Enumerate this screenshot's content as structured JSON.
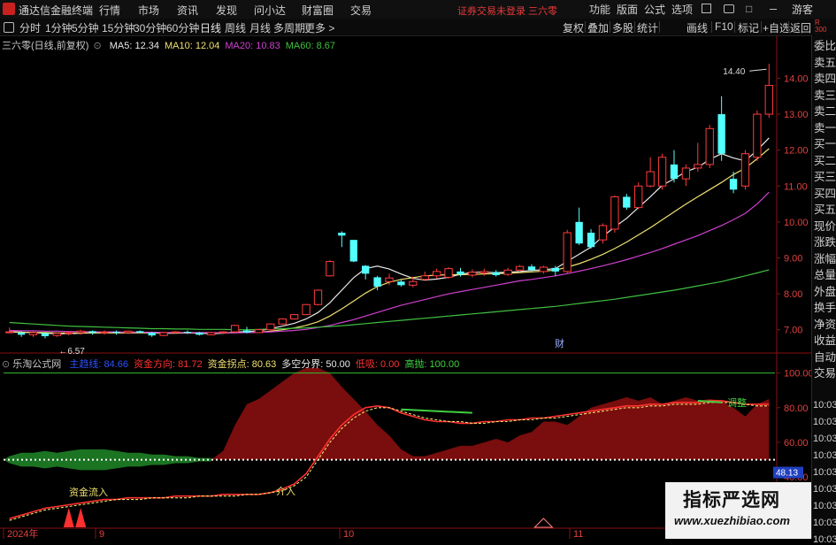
{
  "app": {
    "title": "通达信金融终端",
    "status": "证券交易未登录  三六零"
  },
  "menu": [
    "行情",
    "市场",
    "资讯",
    "发现",
    "问小达",
    "财富圈",
    "交易"
  ],
  "top_right": [
    "功能",
    "版面",
    "公式",
    "选项",
    "游客"
  ],
  "periods": [
    "分时",
    "1分钟",
    "5分钟",
    "15分钟",
    "30分钟",
    "60分钟",
    "日线",
    "周线",
    "月线",
    "多周期",
    "更多 >"
  ],
  "tools": [
    "复权",
    "叠加",
    "多股",
    "统计",
    "画线",
    "F10",
    "标记",
    "+自选",
    "返回"
  ],
  "stock": {
    "name": "三六零(日线,前复权)"
  },
  "ma_legend": [
    {
      "label": "MA5: 12.34",
      "color": "#e8e8e8"
    },
    {
      "label": "MA10: 12.04",
      "color": "#f0e070"
    },
    {
      "label": "MA20: 10.83",
      "color": "#d040d0"
    },
    {
      "label": "MA60: 8.67",
      "color": "#40c040"
    }
  ],
  "indicator": {
    "name": "乐淘公式网",
    "items": [
      {
        "label": "主趋线: 84.66",
        "color": "#3050ff"
      },
      {
        "label": "资金方向: 81.72",
        "color": "#ff3030"
      },
      {
        "label": "资金拐点: 80.63",
        "color": "#f0e070"
      },
      {
        "label": "多空分界: 50.00",
        "color": "#e8e8e8"
      },
      {
        "label": "低吸: 0.00",
        "color": "#ff3030"
      },
      {
        "label": "高抛: 100.00",
        "color": "#40d040"
      }
    ]
  },
  "right_panel": [
    "委比",
    "卖五",
    "卖四",
    "卖三",
    "卖二",
    "卖一",
    "买一",
    "买二",
    "买三",
    "买四",
    "买五",
    "现价",
    "涨跌",
    "涨幅",
    "总量",
    "外盘",
    "换手",
    "净资",
    "收益",
    "自动",
    "交易"
  ],
  "right_times": [
    "10:03",
    "10:03",
    "10:03",
    "10:03",
    "10:03",
    "10:03",
    "10:03",
    "10:03",
    "10:03"
  ],
  "annotations": {
    "high": "14.40",
    "low": "6.57",
    "cai": "财",
    "zijin": "资金流入",
    "jieru": "介入",
    "tiaozheng": "调整",
    "current": "48.13"
  },
  "x_labels": [
    "2024年",
    "9",
    "10",
    "11"
  ],
  "watermark": {
    "line1": "指标严选网",
    "line2": "www.xuezhibiao.com"
  },
  "chart_data": [
    {
      "type": "candlestick",
      "title": "三六零(日线,前复权)",
      "yticks": [
        7.0,
        8.0,
        9.0,
        10.0,
        11.0,
        12.0,
        13.0,
        14.0
      ],
      "ylim": [
        6.45,
        14.75
      ],
      "xlabels": [
        "2024年",
        "9",
        "10",
        "11"
      ],
      "candles": [
        [
          6.94,
          6.94,
          7.06,
          6.9,
          "up"
        ],
        [
          6.92,
          6.86,
          6.96,
          6.8,
          "down"
        ],
        [
          6.86,
          6.92,
          6.96,
          6.8,
          "up"
        ],
        [
          6.9,
          6.82,
          6.92,
          6.76,
          "down"
        ],
        [
          6.84,
          6.9,
          6.92,
          6.8,
          "up"
        ],
        [
          6.9,
          6.92,
          6.96,
          6.84,
          "up"
        ],
        [
          6.92,
          6.96,
          7.0,
          6.86,
          "up"
        ],
        [
          6.96,
          6.92,
          6.98,
          6.86,
          "down"
        ],
        [
          6.92,
          6.94,
          6.98,
          6.86,
          "up"
        ],
        [
          6.94,
          6.92,
          6.98,
          6.86,
          "down"
        ],
        [
          6.92,
          6.96,
          6.98,
          6.88,
          "up"
        ],
        [
          6.96,
          6.92,
          6.98,
          6.9,
          "down"
        ],
        [
          6.92,
          6.84,
          6.94,
          6.8,
          "down"
        ],
        [
          6.84,
          6.92,
          6.94,
          6.82,
          "up"
        ],
        [
          6.92,
          6.94,
          6.96,
          6.88,
          "up"
        ],
        [
          6.94,
          6.92,
          6.98,
          6.88,
          "down"
        ],
        [
          6.92,
          6.86,
          6.94,
          6.84,
          "down"
        ],
        [
          6.86,
          6.92,
          6.94,
          6.84,
          "up"
        ],
        [
          6.92,
          6.94,
          6.96,
          6.9,
          "up"
        ],
        [
          6.94,
          7.12,
          7.14,
          6.92,
          "up"
        ],
        [
          6.98,
          6.92,
          7.08,
          6.9,
          "down"
        ],
        [
          6.92,
          7.0,
          7.02,
          6.92,
          "up"
        ],
        [
          7.0,
          7.16,
          7.18,
          6.98,
          "up"
        ],
        [
          7.16,
          7.3,
          7.32,
          7.14,
          "up"
        ],
        [
          7.3,
          7.42,
          7.44,
          7.28,
          "up"
        ],
        [
          7.42,
          7.7,
          7.72,
          7.4,
          "up"
        ],
        [
          7.7,
          8.1,
          8.12,
          7.68,
          "up"
        ],
        [
          8.5,
          8.9,
          8.94,
          8.48,
          "up"
        ],
        [
          9.7,
          9.62,
          9.74,
          9.3,
          "down"
        ],
        [
          9.5,
          8.9,
          9.5,
          8.88,
          "down"
        ],
        [
          8.78,
          8.56,
          8.8,
          8.4,
          "down"
        ],
        [
          8.46,
          8.2,
          8.5,
          8.1,
          "down"
        ],
        [
          8.34,
          8.44,
          8.56,
          8.24,
          "up"
        ],
        [
          8.34,
          8.24,
          8.4,
          8.2,
          "down"
        ],
        [
          8.24,
          8.34,
          8.48,
          8.18,
          "up"
        ],
        [
          8.4,
          8.5,
          8.62,
          8.36,
          "up"
        ],
        [
          8.5,
          8.62,
          8.7,
          8.42,
          "up"
        ],
        [
          8.46,
          8.7,
          8.74,
          8.42,
          "up"
        ],
        [
          8.62,
          8.54,
          8.72,
          8.48,
          "down"
        ],
        [
          8.52,
          8.6,
          8.68,
          8.46,
          "up"
        ],
        [
          8.58,
          8.62,
          8.7,
          8.5,
          "up"
        ],
        [
          8.6,
          8.52,
          8.66,
          8.48,
          "down"
        ],
        [
          8.54,
          8.66,
          8.72,
          8.5,
          "up"
        ],
        [
          8.66,
          8.76,
          8.8,
          8.6,
          "up"
        ],
        [
          8.76,
          8.66,
          8.82,
          8.62,
          "down"
        ],
        [
          8.62,
          8.74,
          8.78,
          8.56,
          "up"
        ],
        [
          8.72,
          8.62,
          8.78,
          8.5,
          "down"
        ],
        [
          8.62,
          9.7,
          9.78,
          8.58,
          "up"
        ],
        [
          10.0,
          9.4,
          10.4,
          9.36,
          "down"
        ],
        [
          9.7,
          9.3,
          9.8,
          9.26,
          "down"
        ],
        [
          9.5,
          9.9,
          9.96,
          9.4,
          "up"
        ],
        [
          9.8,
          10.7,
          10.74,
          9.7,
          "up"
        ],
        [
          10.7,
          10.4,
          10.78,
          10.34,
          "down"
        ],
        [
          10.4,
          11.0,
          11.1,
          10.36,
          "up"
        ],
        [
          11.0,
          11.4,
          11.8,
          10.96,
          "up"
        ],
        [
          11.0,
          11.8,
          11.9,
          10.9,
          "up"
        ],
        [
          11.6,
          11.2,
          12.0,
          11.1,
          "down"
        ],
        [
          11.2,
          11.5,
          11.6,
          11.0,
          "up"
        ],
        [
          11.5,
          11.6,
          12.2,
          11.4,
          "up"
        ],
        [
          11.6,
          12.6,
          12.7,
          11.5,
          "up"
        ],
        [
          13.0,
          11.9,
          13.5,
          11.7,
          "down"
        ],
        [
          11.2,
          10.9,
          11.4,
          10.8,
          "down"
        ],
        [
          11.0,
          11.9,
          12.0,
          10.9,
          "up"
        ],
        [
          11.8,
          13.0,
          13.1,
          11.7,
          "up"
        ],
        [
          13.0,
          13.8,
          14.4,
          12.9,
          "up"
        ]
      ],
      "ma_lines": [
        {
          "name": "MA5",
          "color": "#e8e8e8",
          "values": [
            6.95,
            6.93,
            6.92,
            6.9,
            6.89,
            6.89,
            6.9,
            6.91,
            6.92,
            6.92,
            6.93,
            6.93,
            6.91,
            6.9,
            6.9,
            6.91,
            6.9,
            6.89,
            6.9,
            6.93,
            6.95,
            6.97,
            7.03,
            7.1,
            7.18,
            7.3,
            7.48,
            7.75,
            8.1,
            8.45,
            8.7,
            8.77,
            8.69,
            8.55,
            8.43,
            8.38,
            8.41,
            8.46,
            8.54,
            8.6,
            8.6,
            8.59,
            8.6,
            8.62,
            8.65,
            8.67,
            8.7,
            8.9,
            9.1,
            9.3,
            9.6,
            9.86,
            10.1,
            10.4,
            10.7,
            11.02,
            11.2,
            11.4,
            11.52,
            11.74,
            11.9,
            11.78,
            11.7,
            12.0,
            12.34
          ]
        },
        {
          "name": "MA10",
          "color": "#f0e070",
          "values": [
            6.93,
            6.93,
            6.92,
            6.92,
            6.91,
            6.91,
            6.91,
            6.91,
            6.91,
            6.91,
            6.91,
            6.91,
            6.91,
            6.91,
            6.91,
            6.91,
            6.91,
            6.91,
            6.91,
            6.92,
            6.92,
            6.93,
            6.96,
            7.0,
            7.05,
            7.12,
            7.22,
            7.38,
            7.58,
            7.8,
            8.02,
            8.2,
            8.32,
            8.4,
            8.45,
            8.5,
            8.52,
            8.53,
            8.53,
            8.54,
            8.55,
            8.56,
            8.57,
            8.59,
            8.61,
            8.63,
            8.66,
            8.74,
            8.84,
            8.96,
            9.1,
            9.26,
            9.44,
            9.64,
            9.84,
            10.06,
            10.28,
            10.5,
            10.7,
            10.9,
            11.1,
            11.32,
            11.5,
            11.76,
            12.04
          ]
        },
        {
          "name": "MA20",
          "color": "#d040d0",
          "values": [
            6.98,
            6.97,
            6.97,
            6.96,
            6.96,
            6.95,
            6.95,
            6.94,
            6.94,
            6.94,
            6.93,
            6.93,
            6.93,
            6.92,
            6.92,
            6.92,
            6.92,
            6.92,
            6.91,
            6.91,
            6.92,
            6.93,
            6.94,
            6.96,
            6.98,
            7.01,
            7.06,
            7.12,
            7.2,
            7.28,
            7.38,
            7.48,
            7.58,
            7.68,
            7.76,
            7.84,
            7.92,
            8.0,
            8.06,
            8.12,
            8.18,
            8.24,
            8.3,
            8.36,
            8.4,
            8.45,
            8.5,
            8.56,
            8.63,
            8.7,
            8.78,
            8.86,
            8.95,
            9.05,
            9.15,
            9.26,
            9.38,
            9.5,
            9.62,
            9.76,
            9.9,
            10.06,
            10.24,
            10.5,
            10.83
          ]
        },
        {
          "name": "MA60",
          "color": "#40c040",
          "values": [
            7.2,
            7.18,
            7.16,
            7.14,
            7.12,
            7.1,
            7.09,
            7.08,
            7.07,
            7.06,
            7.05,
            7.04,
            7.03,
            7.03,
            7.02,
            7.02,
            7.01,
            7.01,
            7.01,
            7.0,
            7.0,
            7.01,
            7.02,
            7.03,
            7.04,
            7.05,
            7.07,
            7.09,
            7.11,
            7.14,
            7.17,
            7.2,
            7.23,
            7.26,
            7.29,
            7.32,
            7.35,
            7.38,
            7.41,
            7.44,
            7.47,
            7.5,
            7.53,
            7.56,
            7.59,
            7.62,
            7.65,
            7.69,
            7.73,
            7.77,
            7.81,
            7.85,
            7.9,
            7.95,
            8.0,
            8.05,
            8.1,
            8.16,
            8.22,
            8.28,
            8.34,
            8.42,
            8.5,
            8.58,
            8.67
          ]
        }
      ]
    },
    {
      "type": "area",
      "title": "乐淘公式网",
      "yticks": [
        40.0,
        60.0,
        80.0,
        100.0
      ],
      "ylim": [
        11,
        110
      ],
      "series": [
        {
          "name": "资金方向",
          "color": "#ff3030",
          "values": [
            16,
            18,
            20,
            22,
            23,
            24,
            25,
            26,
            27,
            27,
            28,
            28,
            28,
            28,
            29,
            29,
            29,
            29,
            30,
            30,
            30,
            30,
            31,
            33,
            36,
            42,
            52,
            62,
            70,
            76,
            80,
            81,
            80,
            77,
            75,
            73,
            72,
            72,
            71,
            71,
            72,
            72,
            73,
            73,
            74,
            74,
            75,
            76,
            77,
            78,
            79,
            80,
            81,
            81,
            82,
            82,
            83,
            83,
            83,
            84,
            84,
            83,
            82,
            82,
            82
          ]
        },
        {
          "name": "资金拐点",
          "color": "#f0e070",
          "values": [
            15,
            17,
            19,
            21,
            22,
            23,
            24,
            25,
            26,
            27,
            27,
            27,
            28,
            28,
            28,
            28,
            29,
            29,
            29,
            29,
            30,
            30,
            31,
            32,
            35,
            40,
            50,
            60,
            68,
            74,
            78,
            80,
            80,
            78,
            76,
            74,
            73,
            72,
            72,
            71,
            71,
            72,
            72,
            73,
            73,
            74,
            74,
            75,
            76,
            77,
            78,
            79,
            80,
            80,
            81,
            81,
            82,
            82,
            82,
            83,
            83,
            83,
            82,
            81,
            81
          ]
        }
      ]
    }
  ]
}
